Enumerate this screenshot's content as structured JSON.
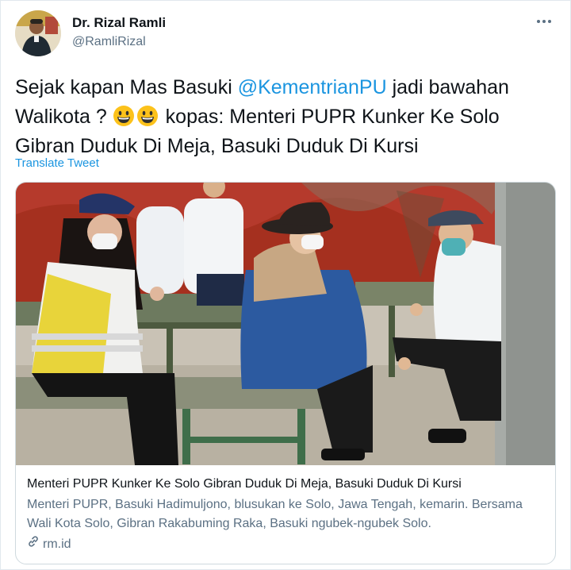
{
  "author": {
    "name": "Dr. Rizal Ramli",
    "handle": "@RamliRizal"
  },
  "tweet": {
    "text_before": "Sejak kapan Mas Basuki ",
    "mention": "@KementrianPU",
    "text_middle": " jadi bawahan Walikota ? ",
    "emojis": [
      "grinning-face",
      "grinning-face"
    ],
    "text_after": " kopas: Menteri PUPR Kunker Ke Solo Gibran Duduk Di Meja, Basuki Duduk Di Kursi",
    "translate_label": "Translate Tweet"
  },
  "card": {
    "title": "Menteri PUPR Kunker Ke Solo Gibran Duduk Di Meja, Basuki Duduk Di Kursi",
    "description": "Menteri PUPR, Basuki Hadimuljono, blusukan ke Solo, Jawa Tengah, kemarin. Bersama Wali Kota Solo, Gibran Rakabuming Raka, Basuki ngubek-ngubek Solo.",
    "domain": "rm.id"
  },
  "colors": {
    "link": "#1b95e0",
    "secondary_text": "#5b7083",
    "primary_text": "#0f1419",
    "border": "#cfd9de"
  },
  "icons": [
    "more-options-icon",
    "link-icon",
    "grinning-face-emoji"
  ]
}
